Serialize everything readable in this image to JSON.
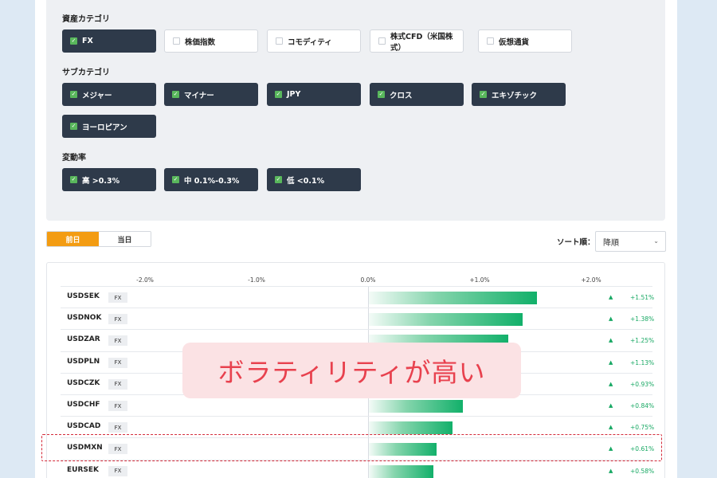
{
  "filters": {
    "asset_category": {
      "label": "資産カテゴリ",
      "chips": [
        {
          "label": "FX",
          "checked": true
        },
        {
          "label": "株価指数",
          "checked": false
        },
        {
          "label": "コモディティ",
          "checked": false
        },
        {
          "label": "株式CFD（米国株式）",
          "checked": false
        },
        {
          "label": "仮想通貨",
          "checked": false
        }
      ]
    },
    "sub_category": {
      "label": "サブカテゴリ",
      "chips": [
        {
          "label": "メジャー",
          "checked": true
        },
        {
          "label": "マイナー",
          "checked": true
        },
        {
          "label": "JPY",
          "checked": true
        },
        {
          "label": "クロス",
          "checked": true
        },
        {
          "label": "エキゾチック",
          "checked": true
        },
        {
          "label": "ヨーロピアン",
          "checked": true
        }
      ]
    },
    "volatility": {
      "label": "変動率",
      "chips": [
        {
          "label": "高 >0.3%",
          "checked": true
        },
        {
          "label": "中 0.1%-0.3%",
          "checked": true
        },
        {
          "label": "低 <0.1%",
          "checked": true
        }
      ]
    }
  },
  "tabs": [
    "前日",
    "当日"
  ],
  "sort": {
    "label": "ソート順：",
    "value": "降順"
  },
  "chart_data": {
    "type": "bar",
    "orientation": "horizontal",
    "x_ticks": [
      "-2.0%",
      "-1.0%",
      "0.0%",
      "+1.0%",
      "+2.0%"
    ],
    "xlim": [
      -2.0,
      2.0
    ],
    "categories": [
      "USDSEK",
      "USDNOK",
      "USDZAR",
      "USDPLN",
      "USDCZK",
      "USDCHF",
      "USDCAD",
      "USDMXN",
      "EURSEK"
    ],
    "tags": [
      "FX",
      "FX",
      "FX",
      "FX",
      "FX",
      "FX",
      "FX",
      "FX",
      "FX"
    ],
    "values": [
      1.51,
      1.38,
      1.25,
      1.13,
      0.93,
      0.84,
      0.75,
      0.61,
      0.58
    ],
    "value_labels": [
      "+1.51%",
      "+1.38%",
      "+1.25%",
      "+1.13%",
      "+0.93%",
      "+0.84%",
      "+0.75%",
      "+0.61%",
      "+0.58%"
    ],
    "bar_color": "#12b06a"
  },
  "callout": "ボラティリティが高い",
  "colors": {
    "chip_active": "#2e3a4a",
    "tab_active": "#f39c12",
    "highlight": "#d42a3a",
    "callout_text": "#e8414e",
    "positive": "#17a863"
  }
}
